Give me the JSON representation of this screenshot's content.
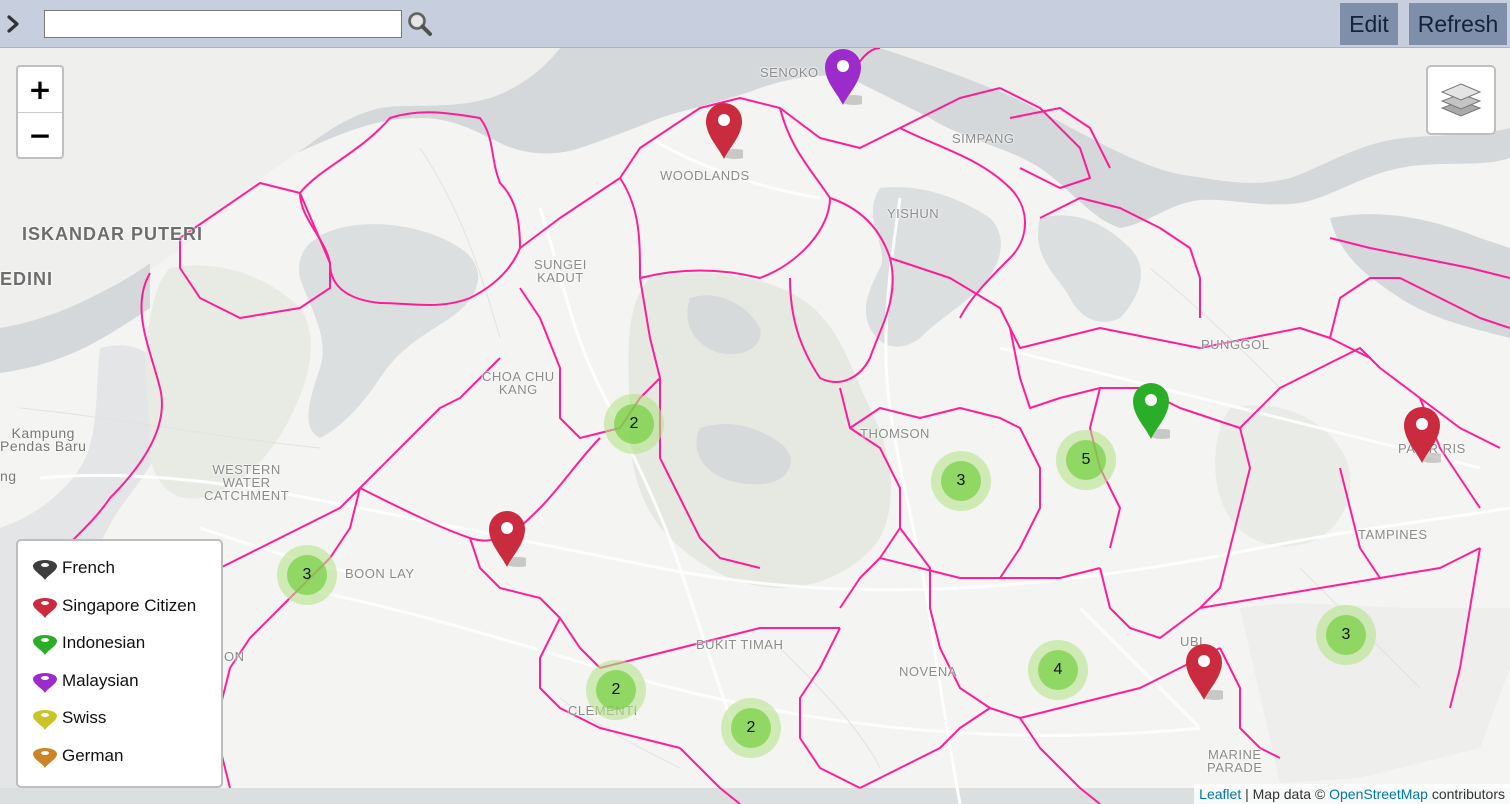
{
  "toolbar": {
    "search_placeholder": "",
    "search_value": "",
    "edit_label": "Edit",
    "refresh_label": "Refresh"
  },
  "map": {
    "zoom_in_label": "+",
    "zoom_out_label": "−",
    "place_labels": [
      {
        "id": "senoko",
        "text": "SENOKO"
      },
      {
        "id": "simpang",
        "text": "SIMPANG"
      },
      {
        "id": "woodlands",
        "text": "WOODLANDS"
      },
      {
        "id": "yishun",
        "text": "YISHUN"
      },
      {
        "id": "iskandar",
        "text": "ISKANDAR PUTERI"
      },
      {
        "id": "edini",
        "text": "EDINI"
      },
      {
        "id": "sungei-kadut",
        "text": "SUNGEI\nKADUT"
      },
      {
        "id": "punggol",
        "text": "PUNGGOL"
      },
      {
        "id": "choa-chu-kang",
        "text": "CHOA CHU\nKANG"
      },
      {
        "id": "thomson",
        "text": "THOMSON"
      },
      {
        "id": "kampung",
        "text": "Kampung\nPendas Baru"
      },
      {
        "id": "western-water",
        "text": "WESTERN\nWATER\nCATCHMENT"
      },
      {
        "id": "pasir-ris",
        "text": "PASIR RIS"
      },
      {
        "id": "tampines",
        "text": "TAMPINES"
      },
      {
        "id": "boon-lay",
        "text": "BOON LAY"
      },
      {
        "id": "bukit-timah",
        "text": "BUKIT TIMAH"
      },
      {
        "id": "novena",
        "text": "NOVENA"
      },
      {
        "id": "ubi",
        "text": "UBI"
      },
      {
        "id": "clementi",
        "text": "CLEMENTI"
      },
      {
        "id": "marine-parade",
        "text": "MARINE\nPARADE"
      },
      {
        "id": "on-fragment",
        "text": "ON"
      },
      {
        "id": "ng-fragment",
        "text": "ng"
      }
    ],
    "markers": [
      {
        "id": "purple-senoko",
        "nationality": "Malaysian",
        "color": "#9c2bcb"
      },
      {
        "id": "red-woodlands",
        "nationality": "Singapore Citizen",
        "color": "#cb2b3e"
      },
      {
        "id": "green-punggol",
        "nationality": "Indonesian",
        "color": "#2aad27"
      },
      {
        "id": "red-pasir-ris",
        "nationality": "Singapore Citizen",
        "color": "#cb2b3e"
      },
      {
        "id": "red-boon-lay",
        "nationality": "Singapore Citizen",
        "color": "#cb2b3e"
      },
      {
        "id": "red-ubi",
        "nationality": "Singapore Citizen",
        "color": "#cb2b3e"
      }
    ],
    "clusters": [
      {
        "id": "cluster-1",
        "count": "2"
      },
      {
        "id": "cluster-2",
        "count": "5"
      },
      {
        "id": "cluster-3",
        "count": "3"
      },
      {
        "id": "cluster-4",
        "count": "3"
      },
      {
        "id": "cluster-5",
        "count": "3"
      },
      {
        "id": "cluster-6",
        "count": "4"
      },
      {
        "id": "cluster-7",
        "count": "2"
      },
      {
        "id": "cluster-8",
        "count": "2"
      }
    ]
  },
  "legend": {
    "items": [
      {
        "label": "French",
        "color": "#3d3d3d"
      },
      {
        "label": "Singapore Citizen",
        "color": "#cb2b3e"
      },
      {
        "label": "Indonesian",
        "color": "#2aad27"
      },
      {
        "label": "Malaysian",
        "color": "#9c2bcb"
      },
      {
        "label": "Swiss",
        "color": "#cac428"
      },
      {
        "label": "German",
        "color": "#cb8427"
      }
    ]
  },
  "attribution": {
    "leaflet": "Leaflet",
    "separator": " | Map data © ",
    "osm": "OpenStreetMap",
    "suffix": " contributors"
  },
  "colors": {
    "boundary": "#ff1493",
    "water": "#d4d8db",
    "land": "#f4f4f2",
    "green_area": "#e8ebe4",
    "toolbar_bg": "#c7cedd",
    "button_bg": "#7f8fa9"
  }
}
